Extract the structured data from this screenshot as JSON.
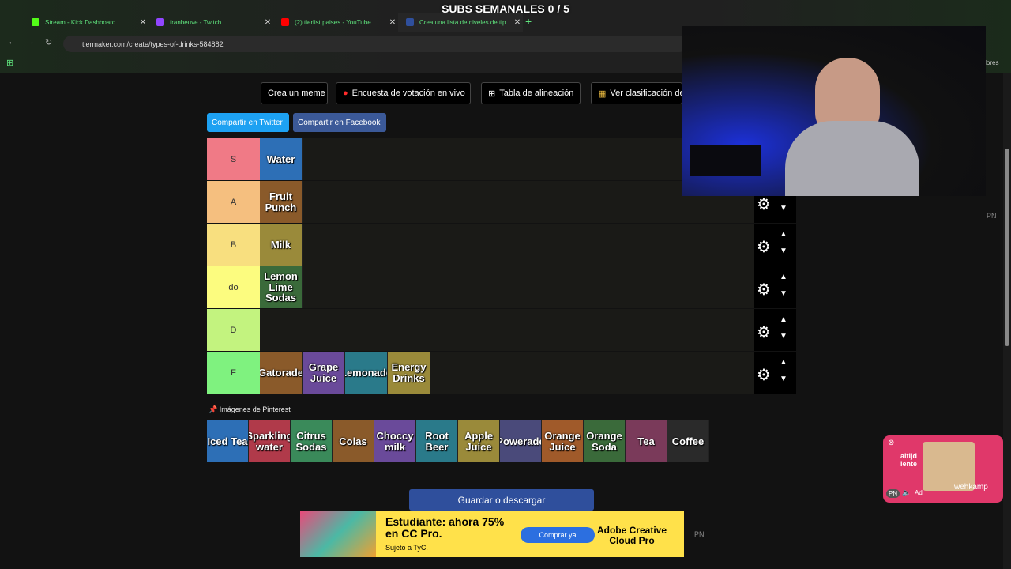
{
  "overlay": {
    "title": "SUBS SEMANALES 0 / 5"
  },
  "browser": {
    "tabs": [
      {
        "label": "Stream - Kick Dashboard",
        "color": "#53fc18"
      },
      {
        "label": "franbeuve - Twitch",
        "color": "#9146ff"
      },
      {
        "label": "(2) tierlist paises - YouTube",
        "color": "#ff0000"
      },
      {
        "label": "Crea una lista de niveles de tip",
        "color": "#2f4f9c"
      }
    ],
    "url": "tiermaker.com/create/types-of-drinks-584882",
    "right_text": "adores"
  },
  "toolbar": {
    "meme": "Crea un meme",
    "poll": "Encuesta de votación en vivo",
    "alignment": "Tabla de alineación",
    "ranking": "Ver clasificación de"
  },
  "share": {
    "twitter": "Compartir en Twitter",
    "facebook": "Compartir en Facebook"
  },
  "tiers": [
    {
      "label": "S",
      "color": "#f07a86",
      "items": [
        "Water"
      ]
    },
    {
      "label": "A",
      "color": "#f5bf7f",
      "items": [
        "Fruit Punch"
      ]
    },
    {
      "label": "B",
      "color": "#f8df7f",
      "items": [
        "Milk"
      ]
    },
    {
      "label": "do",
      "color": "#fcfc7f",
      "items": [
        "Lemon Lime Sodas"
      ]
    },
    {
      "label": "D",
      "color": "#c3f37f",
      "items": []
    },
    {
      "label": "F",
      "color": "#7ff27f",
      "items": [
        "Gatorade",
        "Grape Juice",
        "Lemonade",
        "Energy Drinks"
      ]
    }
  ],
  "pinterest_label": "Imágenes de Pinterest",
  "pool": [
    "Iced Tea",
    "Sparkling water",
    "Citrus Sodas",
    "Colas",
    "Choccy milk",
    "Root Beer",
    "Apple Juice",
    "Powerade",
    "Orange Juice",
    "Orange Soda",
    "Tea",
    "Coffee"
  ],
  "save_button": "Guardar o descargar",
  "ad": {
    "headline": "Estudiante: ahora 75% en CC Pro.",
    "sub": "Sujeto a TyC.",
    "cta": "Comprar ya",
    "brand": "Adobe Creative Cloud Pro"
  },
  "side_ad": {
    "text": "altijd lente",
    "brand": "wehkamp",
    "ad_label": "Ad"
  },
  "pn_label": "PN"
}
